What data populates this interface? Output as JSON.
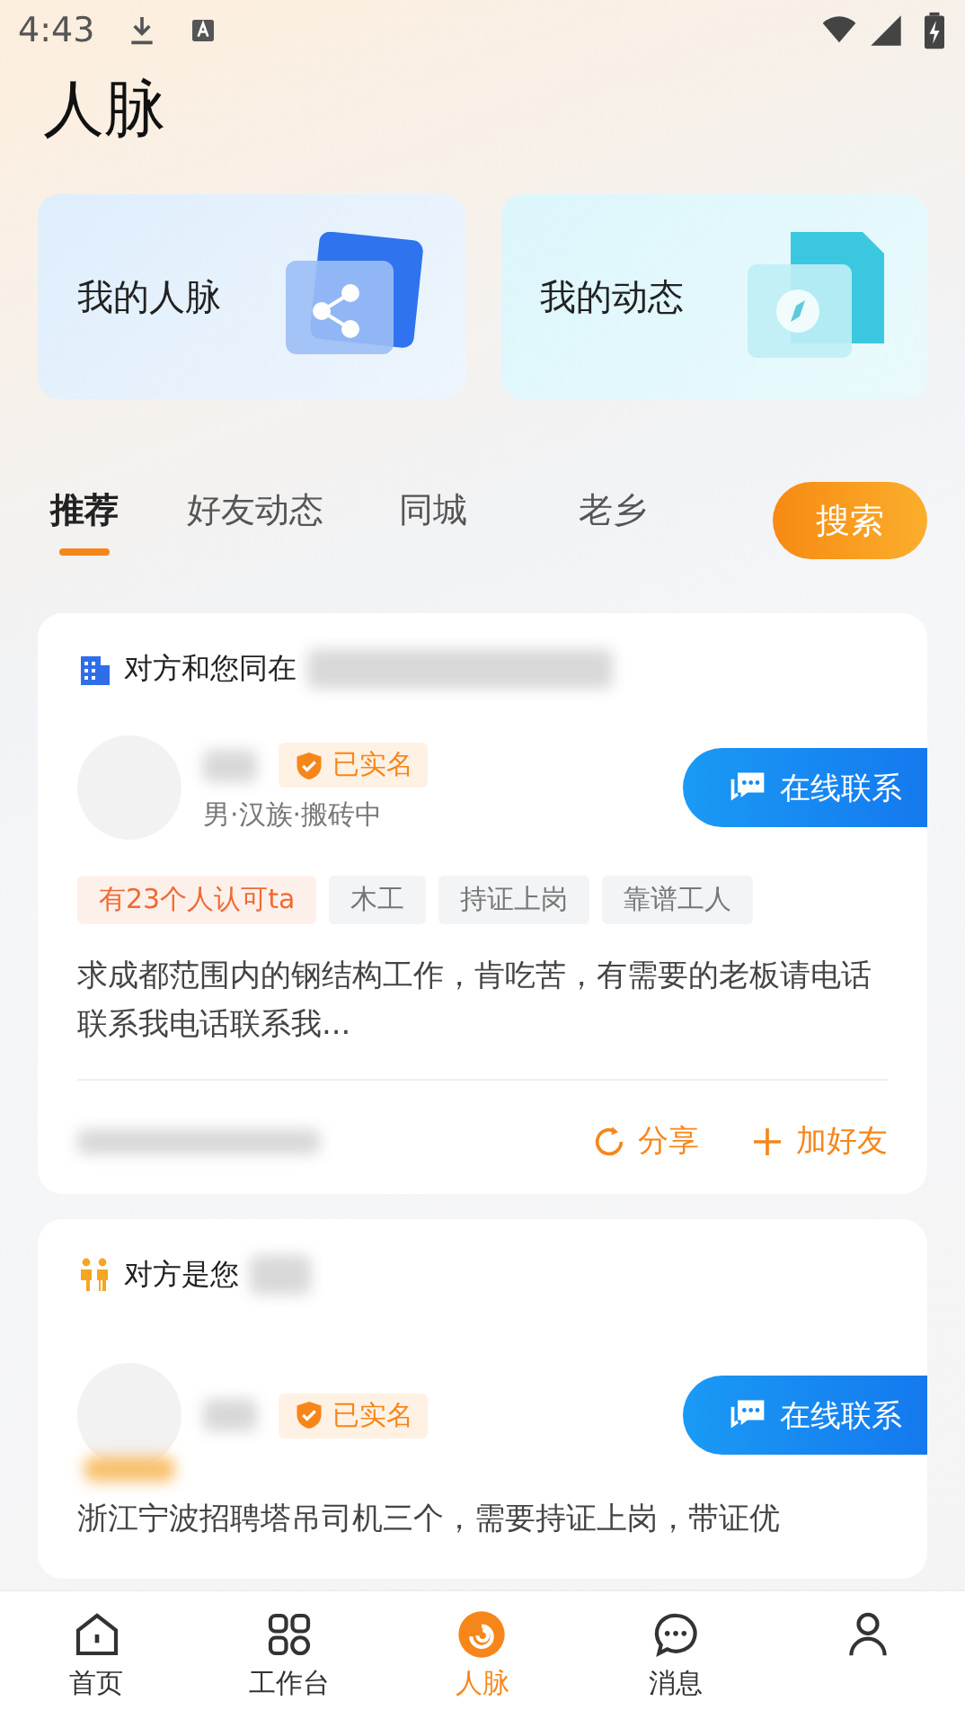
{
  "status_bar": {
    "time": "4:43"
  },
  "title": "人脉",
  "shortcuts": [
    {
      "label": "我的人脉",
      "kind": "network"
    },
    {
      "label": "我的动态",
      "kind": "moments"
    }
  ],
  "tabs": [
    {
      "label": "推荐",
      "selected": true
    },
    {
      "label": "好友动态",
      "selected": false
    },
    {
      "label": "同城",
      "selected": false
    },
    {
      "label": "老乡",
      "selected": false
    }
  ],
  "search_button": "搜索",
  "posts": [
    {
      "kind": "company",
      "relation": "对方和您同在",
      "verified": "已实名",
      "details": "男·汉族·搬砖中",
      "contact": "在线联系",
      "tags": [
        {
          "label": "有23个人认可ta",
          "kind": "highlight"
        },
        {
          "label": "木工",
          "kind": "plain"
        },
        {
          "label": "持证上岗",
          "kind": "plain"
        },
        {
          "label": "靠谱工人",
          "kind": "plain"
        }
      ],
      "description": "求成都范围内的钢结构工作，肯吃苦，有需要的老板请电话联系我电话联系我...",
      "actions": [
        {
          "label": "分享",
          "kind": "share"
        },
        {
          "label": "加好友",
          "kind": "add"
        }
      ]
    },
    {
      "kind": "hometown",
      "relation": "对方是您",
      "verified": "已实名",
      "contact": "在线联系",
      "description": "浙江宁波招聘塔吊司机三个，需要持证上岗，带证优"
    }
  ],
  "nav": [
    {
      "label": "首页",
      "kind": "home",
      "selected": false
    },
    {
      "label": "工作台",
      "kind": "grid",
      "selected": false
    },
    {
      "label": "人脉",
      "kind": "network",
      "selected": true
    },
    {
      "label": "消息",
      "kind": "chat",
      "selected": false
    },
    {
      "kind": "person",
      "selected": false
    }
  ]
}
